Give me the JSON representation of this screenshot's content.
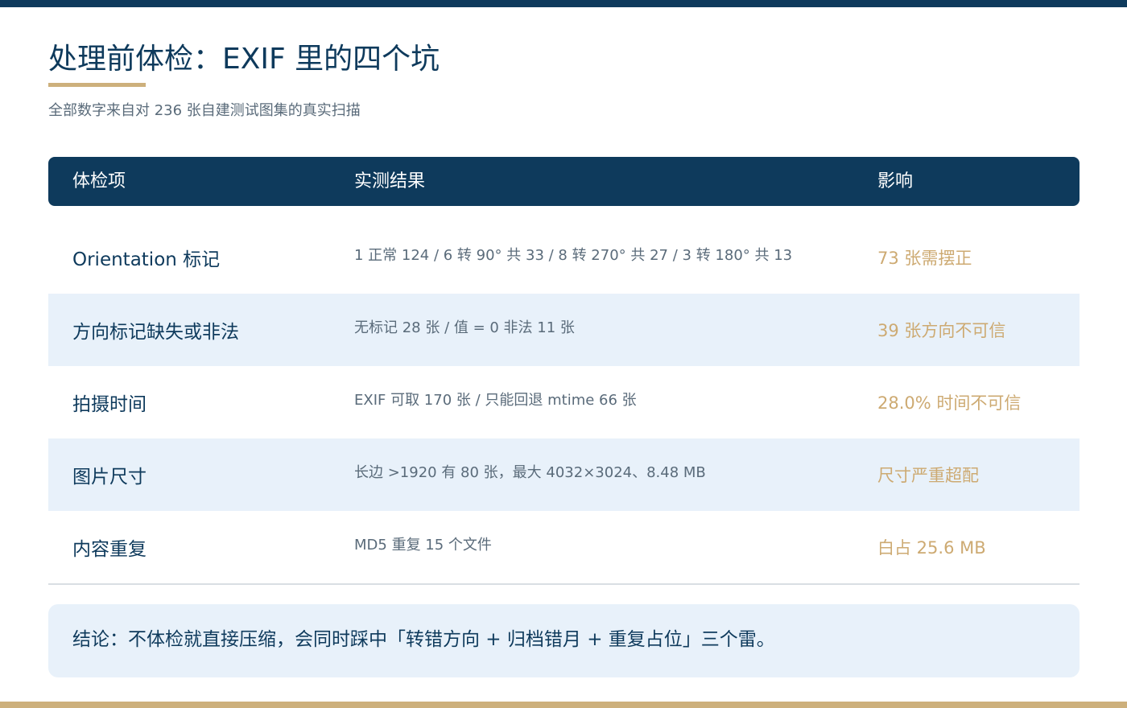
{
  "page": {
    "title": "处理前体检：EXIF 里的四个坑",
    "subtitle": "全部数字来自对 236 张自建测试图集的真实扫描"
  },
  "table": {
    "headers": {
      "item": "体检项",
      "result": "实测结果",
      "impact": "影响"
    },
    "rows": [
      {
        "item": "Orientation 标记",
        "result": "1 正常 124 / 6 转 90° 共 33 / 8 转 270° 共 27 / 3 转 180° 共 13",
        "impact": "73 张需摆正"
      },
      {
        "item": "方向标记缺失或非法",
        "result": "无标记 28 张 / 值 = 0 非法 11 张",
        "impact": "39 张方向不可信"
      },
      {
        "item": "拍摄时间",
        "result": "EXIF 可取 170 张 / 只能回退 mtime 66 张",
        "impact": "28.0% 时间不可信"
      },
      {
        "item": "图片尺寸",
        "result": "长边 >1920 有 80 张，最大 4032×3024、8.48 MB",
        "impact": "尺寸严重超配"
      },
      {
        "item": "内容重复",
        "result": "MD5 重复 15 个文件",
        "impact": "白占 25.6 MB"
      }
    ]
  },
  "conclusion": {
    "text": "结论：不体检就直接压缩，会同时踩中「转错方向 + 归档错月 + 重复占位」三个雷。"
  },
  "colors": {
    "navy": "#0e3a5c",
    "gold": "#cdb07c",
    "impact_text": "#cdaa72",
    "row_alt_bg": "#e8f1fa",
    "muted_text": "#5a6b7a"
  }
}
